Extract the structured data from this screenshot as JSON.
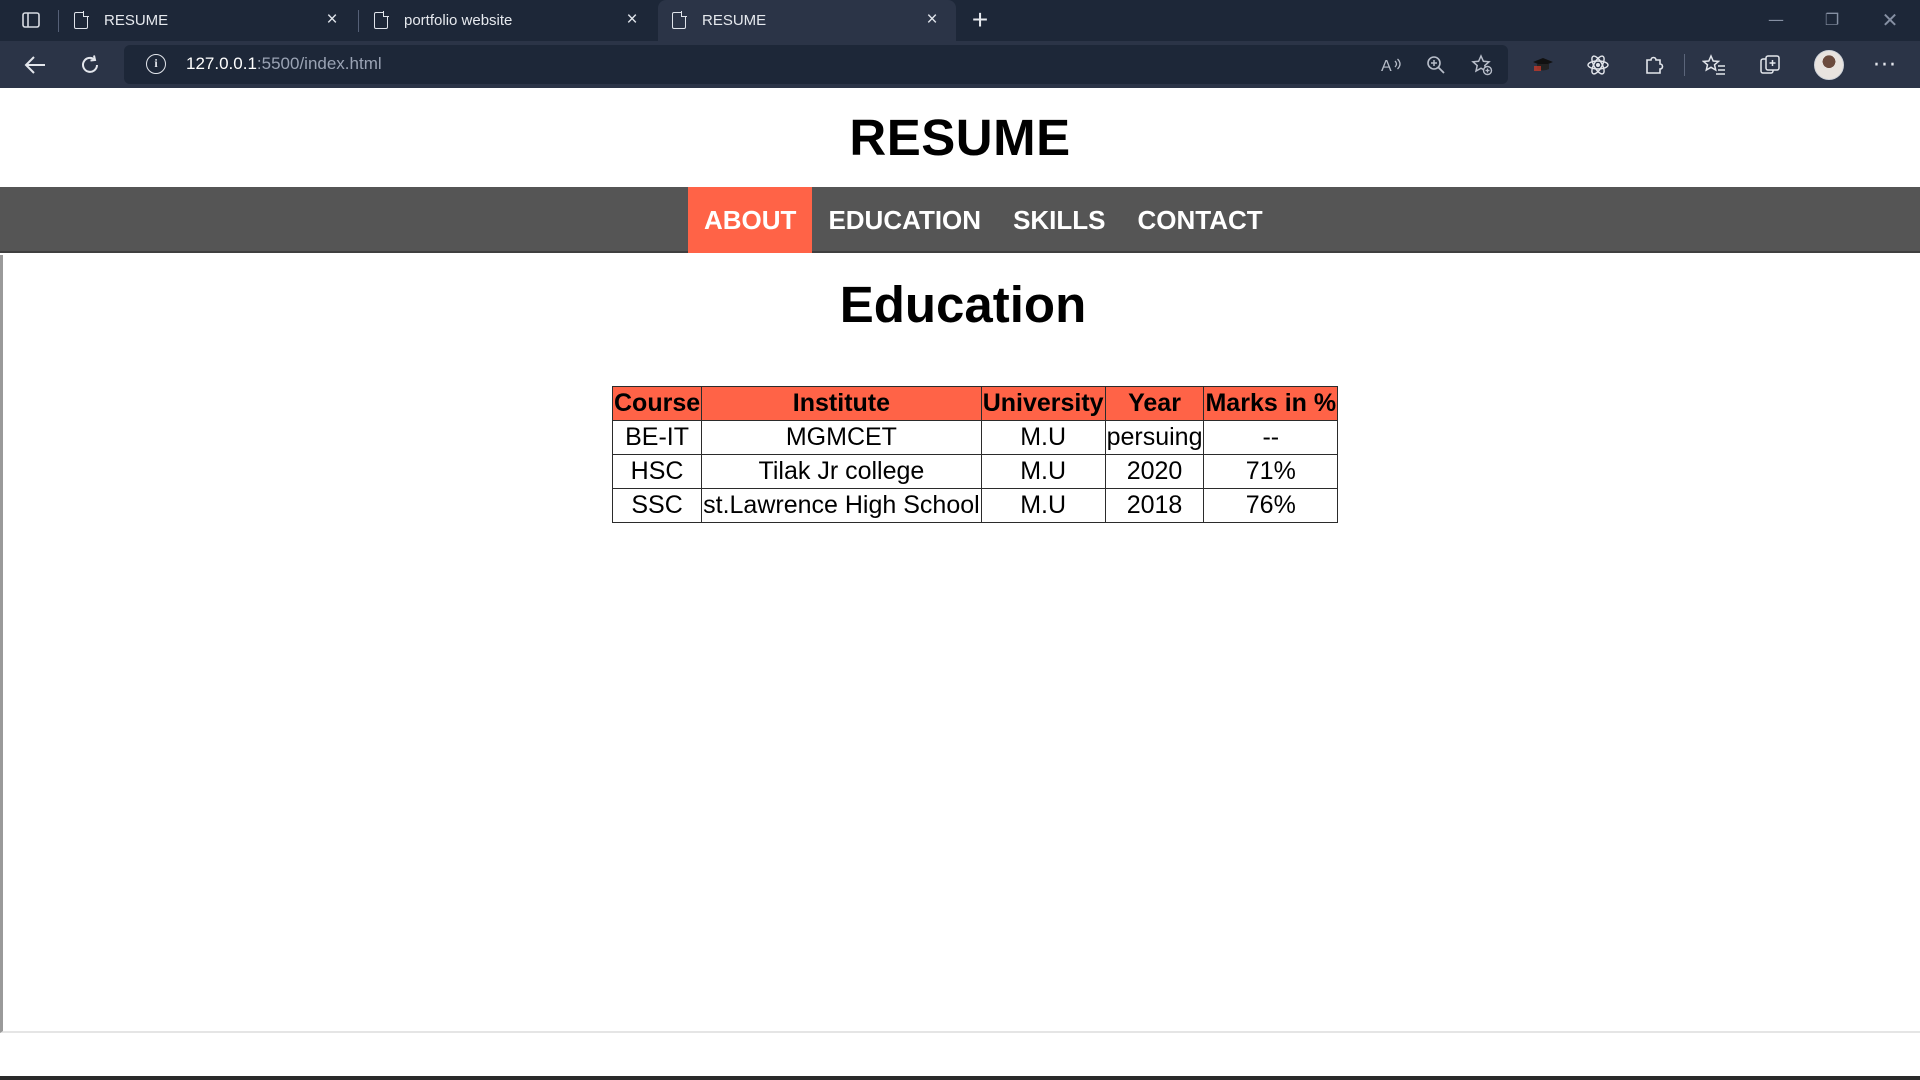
{
  "browser": {
    "tabs": [
      {
        "title": "RESUME",
        "active": false
      },
      {
        "title": "portfolio website",
        "active": false
      },
      {
        "title": "RESUME",
        "active": true
      }
    ],
    "url_host": "127.0.0.1",
    "url_rest": ":5500/index.html",
    "icons": {
      "tab_actions": "tab-actions-icon",
      "back": "back-arrow-icon",
      "refresh": "refresh-icon",
      "site_info": "info-icon",
      "read_aloud": "read-aloud-icon",
      "zoom": "zoom-icon",
      "add_favorite": "add-favorite-icon",
      "extension_1": "extension-badge-icon",
      "react_devtools": "react-atom-icon",
      "extensions": "puzzle-icon",
      "favorites": "favorites-icon",
      "collections": "collections-icon",
      "profile": "profile-avatar",
      "more": "more-icon"
    }
  },
  "page": {
    "title": "RESUME",
    "nav": [
      {
        "label": "ABOUT",
        "active": true
      },
      {
        "label": "EDUCATION",
        "active": false
      },
      {
        "label": "SKILLS",
        "active": false
      },
      {
        "label": "CONTACT",
        "active": false
      }
    ],
    "section_title": "Education",
    "table": {
      "headers": [
        "Course",
        "Institute",
        "University",
        "Year",
        "Marks in %"
      ],
      "rows": [
        [
          "BE-IT",
          "MGMCET",
          "M.U",
          "persuing",
          "--"
        ],
        [
          "HSC",
          "Tilak Jr college",
          "M.U",
          "2020",
          "71%"
        ],
        [
          "SSC",
          "st.Lawrence High School",
          "M.U",
          "2018",
          "76%"
        ]
      ]
    }
  },
  "colors": {
    "accent": "#ff6347",
    "navbar": "#555555",
    "chrome_dark": "#1d2738",
    "chrome_toolbar": "#2b3447"
  }
}
